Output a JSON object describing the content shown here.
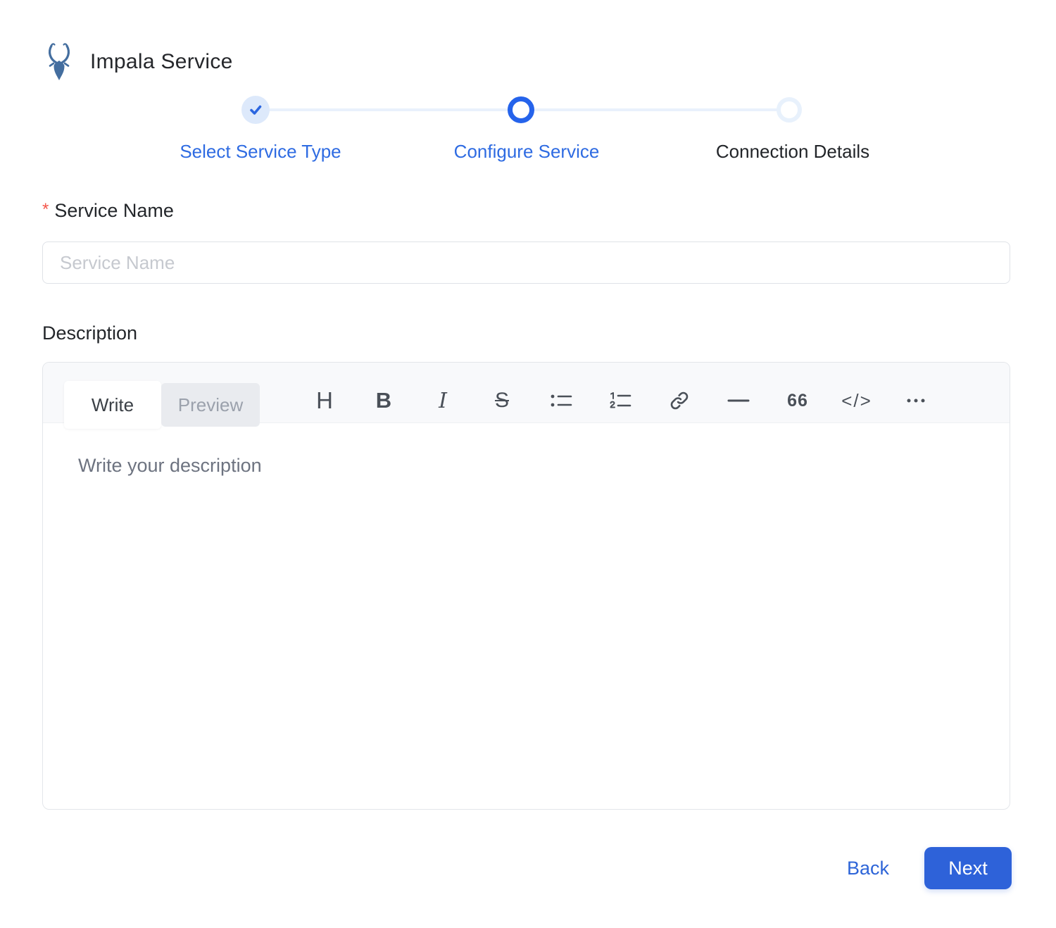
{
  "page": {
    "title": "Impala Service",
    "logo_icon": "impala-logo"
  },
  "stepper": {
    "steps": [
      {
        "label": "Select Service Type",
        "state": "completed",
        "icon": "check-icon"
      },
      {
        "label": "Configure Service",
        "state": "active"
      },
      {
        "label": "Connection Details",
        "state": "pending"
      }
    ]
  },
  "form": {
    "service_name": {
      "label": "Service Name",
      "required_marker": "*",
      "placeholder": "Service Name",
      "value": ""
    },
    "description": {
      "label": "Description",
      "editor": {
        "tabs": [
          {
            "label": "Write",
            "active": true
          },
          {
            "label": "Preview",
            "active": false
          }
        ],
        "toolbar": [
          {
            "name": "heading-icon",
            "glyph": "H"
          },
          {
            "name": "bold-icon",
            "glyph": "B"
          },
          {
            "name": "italic-icon",
            "glyph": "I"
          },
          {
            "name": "strikethrough-icon",
            "glyph": "S"
          },
          {
            "name": "bullet-list-icon",
            "glyph": ""
          },
          {
            "name": "numbered-list-icon",
            "glyph": ""
          },
          {
            "name": "link-icon",
            "glyph": ""
          },
          {
            "name": "horizontal-rule-icon",
            "glyph": ""
          },
          {
            "name": "quote-icon",
            "glyph": "66"
          },
          {
            "name": "code-icon",
            "glyph": "</>"
          },
          {
            "name": "more-icon",
            "glyph": ""
          }
        ],
        "placeholder": "Write your description",
        "value": ""
      }
    }
  },
  "actions": {
    "back_label": "Back",
    "next_label": "Next"
  },
  "colors": {
    "accent_blue": "#2e62d9",
    "step_active_ring": "#2563eb",
    "step_completed_bg": "#dde9fb",
    "step_pending_ring": "#e8f1fc",
    "connector_line": "#e9f1fc",
    "required_red": "#f4564a",
    "placeholder_gray": "#c6c9cf",
    "editor_strip": "#f8f9fb",
    "toolbar_icon": "#4a5058",
    "logo_blue": "#446e9f"
  }
}
